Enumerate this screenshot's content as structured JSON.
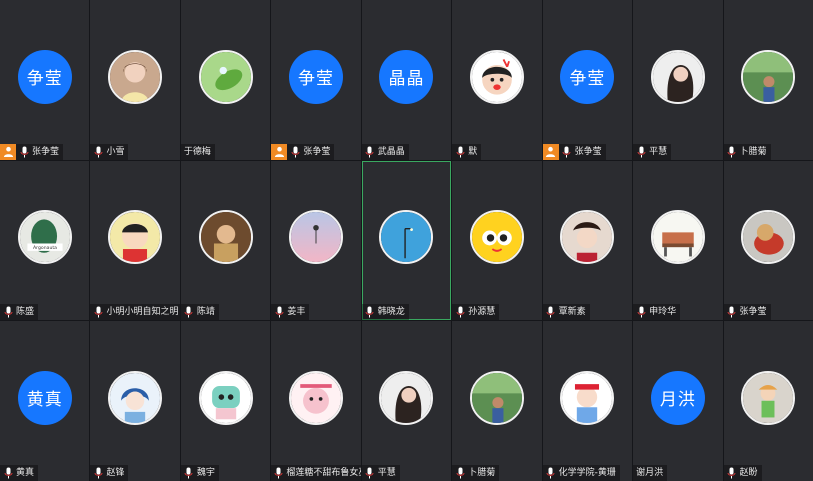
{
  "colors": {
    "avatar_blue": "#1677ff",
    "host_orange": "#f08a24",
    "speaking_border": "#3aa860",
    "tile_bg": "#2b2c30"
  },
  "participants": [
    {
      "name": "张争莹",
      "avatar_text": "争莹",
      "avatar_kind": "text",
      "host": true,
      "mic": true
    },
    {
      "name": "小雪",
      "avatar_icon": "photo-girl-icon",
      "avatar_kind": "img",
      "host": false,
      "mic": true
    },
    {
      "name": "于德梅",
      "avatar_icon": "photo-plant-icon",
      "avatar_kind": "img",
      "host": false,
      "mic": false
    },
    {
      "name": "张争莹",
      "avatar_text": "争莹",
      "avatar_kind": "text",
      "host": true,
      "mic": true
    },
    {
      "name": "武晶晶",
      "avatar_text": "晶晶",
      "avatar_kind": "text",
      "host": false,
      "mic": true
    },
    {
      "name": "默",
      "avatar_icon": "cartoon-kid-icon",
      "avatar_kind": "img",
      "host": false,
      "mic": true
    },
    {
      "name": "张争莹",
      "avatar_text": "争莹",
      "avatar_kind": "text",
      "host": true,
      "mic": true
    },
    {
      "name": "平慧",
      "avatar_icon": "photo-woman-icon",
      "avatar_kind": "img",
      "host": false,
      "mic": true
    },
    {
      "name": "卜腊菊",
      "avatar_icon": "photo-garden-icon",
      "avatar_kind": "img",
      "host": false,
      "mic": true
    },
    {
      "name": "陈盛",
      "avatar_icon": "photo-leaf-icon",
      "avatar_kind": "img",
      "host": false,
      "mic": true
    },
    {
      "name": "小明小明自知之明",
      "avatar_icon": "cartoon-boy-icon",
      "avatar_kind": "img",
      "host": false,
      "mic": true
    },
    {
      "name": "陈靖",
      "avatar_icon": "photo-person-icon",
      "avatar_kind": "img",
      "host": false,
      "mic": true
    },
    {
      "name": "姜丰",
      "avatar_icon": "photo-sunset-icon",
      "avatar_kind": "img",
      "host": false,
      "mic": true
    },
    {
      "name": "韩晓龙",
      "avatar_icon": "photo-sky-icon",
      "avatar_kind": "img",
      "host": false,
      "mic": true,
      "speaking": true
    },
    {
      "name": "孙源慧",
      "avatar_icon": "cartoon-eyes-icon",
      "avatar_kind": "img",
      "host": false,
      "mic": true
    },
    {
      "name": "覃新素",
      "avatar_icon": "photo-costume-icon",
      "avatar_kind": "img",
      "host": false,
      "mic": true
    },
    {
      "name": "申玲华",
      "avatar_icon": "photo-bench-icon",
      "avatar_kind": "img",
      "host": false,
      "mic": true
    },
    {
      "name": "张争莹",
      "avatar_icon": "photo-dog-icon",
      "avatar_kind": "img",
      "host": false,
      "mic": true
    },
    {
      "name": "黄真",
      "avatar_text": "黄真",
      "avatar_kind": "text",
      "host": false,
      "mic": true
    },
    {
      "name": "赵锋",
      "avatar_icon": "anime-boy-icon",
      "avatar_kind": "img",
      "host": false,
      "mic": true
    },
    {
      "name": "魏宇",
      "avatar_icon": "cartoon-face-icon",
      "avatar_kind": "img",
      "host": false,
      "mic": true
    },
    {
      "name": "榴莲糖不甜布鲁女巫",
      "avatar_icon": "cartoon-pink-icon",
      "avatar_kind": "img",
      "host": false,
      "mic": true
    },
    {
      "name": "平慧",
      "avatar_icon": "photo-woman-icon",
      "avatar_kind": "img",
      "host": false,
      "mic": true
    },
    {
      "name": "卜腊菊",
      "avatar_icon": "photo-garden-icon",
      "avatar_kind": "img",
      "host": false,
      "mic": true
    },
    {
      "name": "化学学院-黄珊",
      "avatar_icon": "cartoon-girl-icon",
      "avatar_kind": "img",
      "host": false,
      "mic": true
    },
    {
      "name": "谢月洪",
      "avatar_text": "月洪",
      "avatar_kind": "text",
      "host": false,
      "mic": false
    },
    {
      "name": "赵盼",
      "avatar_icon": "cartoon-green-icon",
      "avatar_kind": "img",
      "host": false,
      "mic": true
    }
  ]
}
